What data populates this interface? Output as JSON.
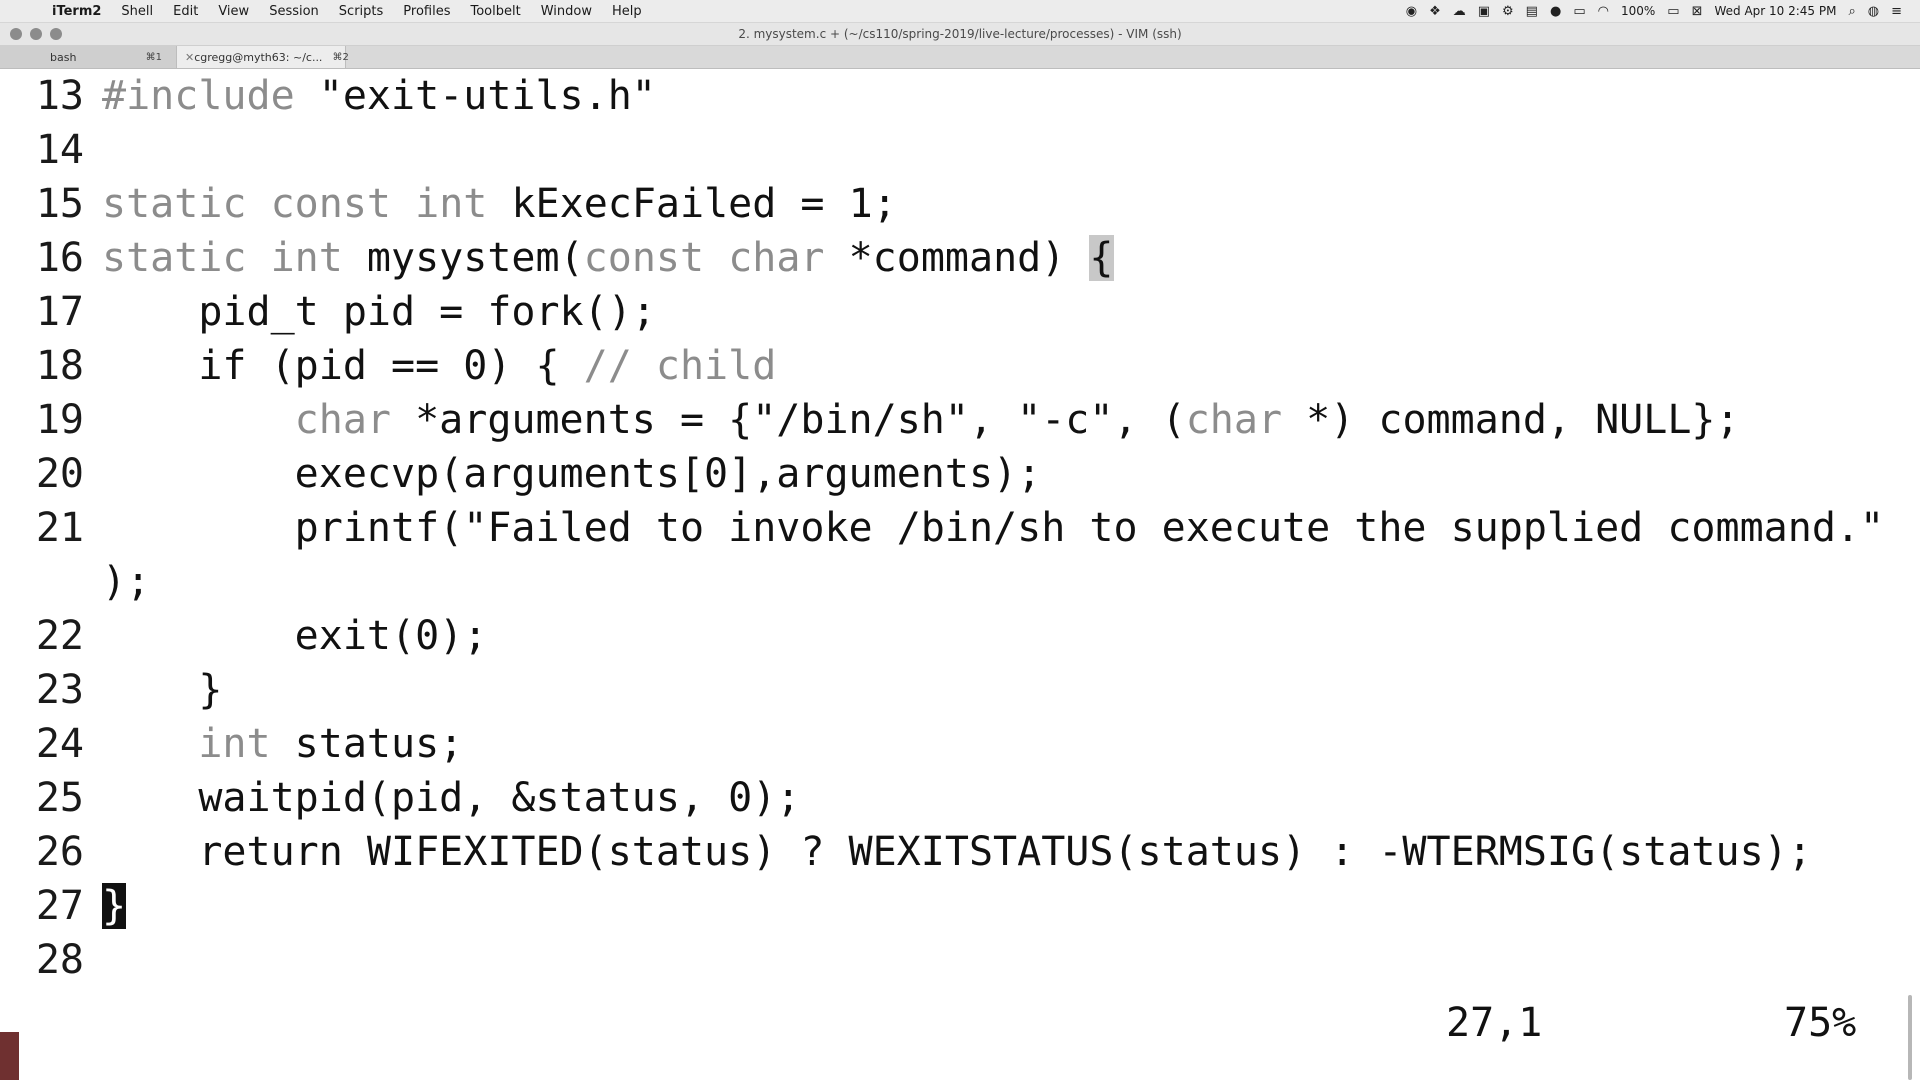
{
  "menubar": {
    "items": [
      "iTerm2",
      "Shell",
      "Edit",
      "View",
      "Session",
      "Scripts",
      "Profiles",
      "Toolbelt",
      "Window",
      "Help"
    ],
    "battery": "100%",
    "clock": "Wed Apr 10  2:45 PM"
  },
  "window": {
    "title": "2. mysystem.c + (~/cs110/spring-2019/live-lecture/processes) - VIM (ssh)"
  },
  "tabs": [
    {
      "label": "bash",
      "shortcut": "⌘1"
    },
    {
      "label": "cgregg@myth63: ~/c...",
      "shortcut": "⌘2"
    }
  ],
  "editor": {
    "lines": [
      {
        "num": "13",
        "code": "#include \"exit-utils.h\""
      },
      {
        "num": "14",
        "code": ""
      },
      {
        "num": "15",
        "code": "static const int kExecFailed = 1;"
      },
      {
        "num": "16",
        "code": "static int mysystem(const char *command) {"
      },
      {
        "num": "17",
        "code": "    pid_t pid = fork();"
      },
      {
        "num": "18",
        "code": "    if (pid == 0) { // child"
      },
      {
        "num": "19",
        "code": "        char *arguments = {\"/bin/sh\", \"-c\", (char *) command, NULL};"
      },
      {
        "num": "20",
        "code": "        execvp(arguments[0],arguments);"
      },
      {
        "num": "21",
        "code": "        printf(\"Failed to invoke /bin/sh to execute the supplied command.\""
      },
      {
        "num": "",
        "code": ");"
      },
      {
        "num": "22",
        "code": "        exit(0);"
      },
      {
        "num": "23",
        "code": "    }"
      },
      {
        "num": "24",
        "code": "    int status;"
      },
      {
        "num": "25",
        "code": "    waitpid(pid, &status, 0);"
      },
      {
        "num": "26",
        "code": "    return WIFEXITED(status) ? WEXITSTATUS(status) : -WTERMSIG(status);"
      },
      {
        "num": "27",
        "code": "}"
      },
      {
        "num": "28",
        "code": ""
      }
    ],
    "cursor_line": "27",
    "position": "27,1",
    "percent": "75%"
  }
}
